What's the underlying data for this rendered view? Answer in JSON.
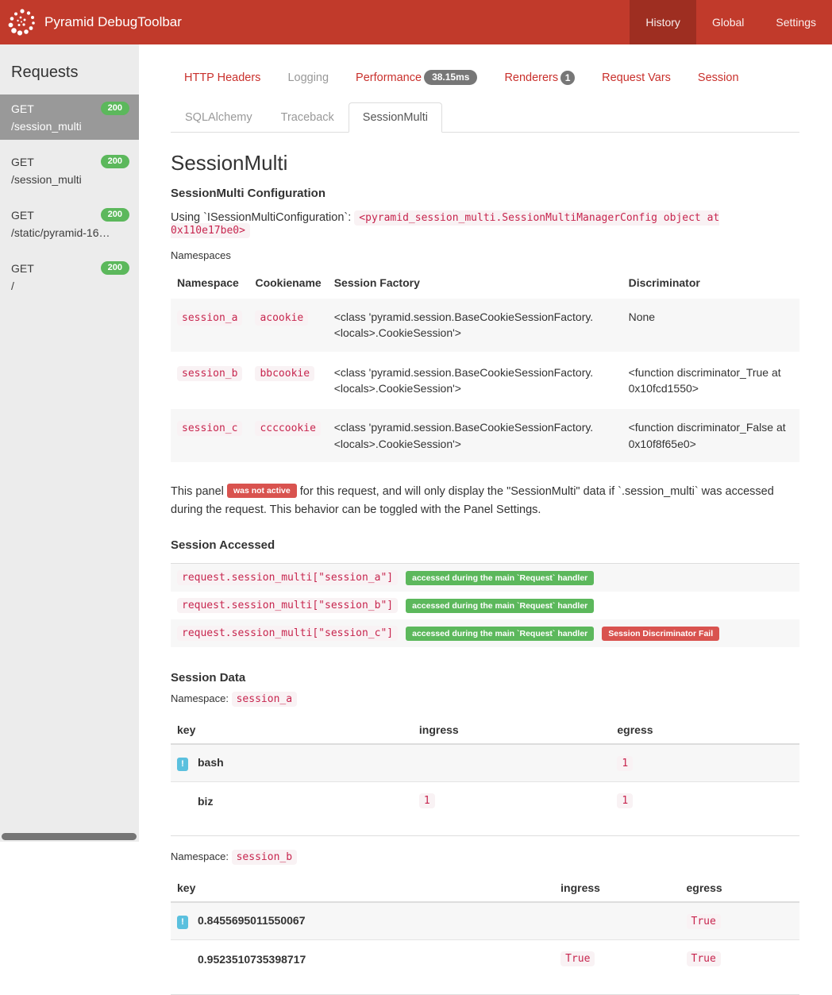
{
  "header": {
    "title": "Pyramid DebugToolbar",
    "nav": [
      {
        "label": "History",
        "active": true
      },
      {
        "label": "Global",
        "active": false
      },
      {
        "label": "Settings",
        "active": false
      }
    ]
  },
  "sidebar": {
    "title": "Requests",
    "items": [
      {
        "method": "GET",
        "path": "/session_multi",
        "status": "200",
        "active": true
      },
      {
        "method": "GET",
        "path": "/session_multi",
        "status": "200",
        "active": false
      },
      {
        "method": "GET",
        "path": "/static/pyramid-16…",
        "status": "200",
        "active": false
      },
      {
        "method": "GET",
        "path": "/",
        "status": "200",
        "active": false
      }
    ]
  },
  "tabs": {
    "row1": [
      {
        "label": "HTTP Headers",
        "state": "link"
      },
      {
        "label": "Logging",
        "state": "disabled"
      },
      {
        "label": "Performance",
        "state": "link",
        "badge": "38.15ms"
      },
      {
        "label": "Renderers",
        "state": "link",
        "badge": "1"
      },
      {
        "label": "Request Vars",
        "state": "link"
      },
      {
        "label": "Session",
        "state": "link"
      }
    ],
    "row2": [
      {
        "label": "SQLAlchemy",
        "state": "disabled"
      },
      {
        "label": "Traceback",
        "state": "disabled"
      },
      {
        "label": "SessionMulti",
        "state": "active"
      }
    ]
  },
  "panel": {
    "title": "SessionMulti",
    "config_heading": "SessionMulti Configuration",
    "using_label": "Using `ISessionMultiConfiguration`:",
    "using_code": "<pyramid_session_multi.SessionMultiManagerConfig object at 0x110e17be0>",
    "namespaces_label": "Namespaces",
    "namespaces_table": {
      "headers": [
        "Namespace",
        "Cookiename",
        "Session Factory",
        "Discriminator"
      ],
      "rows": [
        {
          "namespace": "session_a",
          "cookiename": "acookie",
          "factory": "<class 'pyramid.session.BaseCookieSessionFactory.<locals>.CookieSession'>",
          "discriminator": "None"
        },
        {
          "namespace": "session_b",
          "cookiename": "bbcookie",
          "factory": "<class 'pyramid.session.BaseCookieSessionFactory.<locals>.CookieSession'>",
          "discriminator": "<function discriminator_True at 0x10fcd1550>"
        },
        {
          "namespace": "session_c",
          "cookiename": "ccccookie",
          "factory": "<class 'pyramid.session.BaseCookieSessionFactory.<locals>.CookieSession'>",
          "discriminator": "<function discriminator_False at 0x10f8f65e0>"
        }
      ]
    },
    "notice": {
      "pre": "This panel",
      "badge": "was not active",
      "post": "for this request, and will only display the \"SessionMulti\" data if `.session_multi` was accessed during the request. This behavior can be toggled with the Panel Settings."
    },
    "accessed": {
      "heading": "Session Accessed",
      "rows": [
        {
          "code": "request.session_multi[\"session_a\"]",
          "badges": [
            {
              "label": "accessed during the main `Request` handler",
              "type": "success"
            }
          ]
        },
        {
          "code": "request.session_multi[\"session_b\"]",
          "badges": [
            {
              "label": "accessed during the main `Request` handler",
              "type": "success"
            }
          ]
        },
        {
          "code": "request.session_multi[\"session_c\"]",
          "badges": [
            {
              "label": "accessed during the main `Request` handler",
              "type": "success"
            },
            {
              "label": "Session Discriminator Fail",
              "type": "danger"
            }
          ]
        }
      ]
    },
    "session_data": {
      "heading": "Session Data",
      "namespace_label": "Namespace:",
      "tables": [
        {
          "namespace": "session_a",
          "headers": [
            "key",
            "ingress",
            "egress"
          ],
          "rows": [
            {
              "info": true,
              "key": "bash",
              "ingress": "",
              "egress": "1"
            },
            {
              "info": false,
              "key": "biz",
              "ingress": "1",
              "egress": "1"
            }
          ]
        },
        {
          "namespace": "session_b",
          "headers": [
            "key",
            "ingress",
            "egress"
          ],
          "rows": [
            {
              "info": true,
              "key": "0.8455695011550067",
              "ingress": "",
              "egress": "True"
            },
            {
              "info": false,
              "key": "0.9523510735398717",
              "ingress": "True",
              "egress": "True"
            }
          ]
        }
      ]
    }
  },
  "icons": {
    "info_glyph": "!"
  },
  "colors": {
    "header_red": "#c13a2b",
    "header_active_red": "#9e2e21",
    "tab_link_red": "#c9302c",
    "success_green": "#5cb85c",
    "danger_red": "#d9534f",
    "info_blue": "#5bc0de",
    "code_pink": "#c7254e",
    "code_bg": "#f9f2f4",
    "sidebar_bg": "#ececec",
    "active_item_gray": "#999999"
  }
}
